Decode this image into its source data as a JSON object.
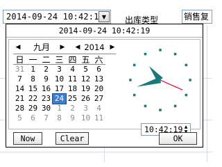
{
  "background": {
    "date_field_value": "2014-09-24 10:42:19",
    "outbound_type_label": "出库类型",
    "sales_box_text": "销售复"
  },
  "picker": {
    "title": "2014-09-24 10:42:19",
    "month": "九月",
    "year": "2014",
    "weekdays": [
      "日",
      "一",
      "二",
      "三",
      "四",
      "五",
      "六"
    ],
    "weeks": [
      [
        "31",
        "1",
        "2",
        "3",
        "4",
        "5",
        "6"
      ],
      [
        "7",
        "8",
        "9",
        "10",
        "11",
        "12",
        "13"
      ],
      [
        "14",
        "15",
        "16",
        "17",
        "18",
        "19",
        "20"
      ],
      [
        "21",
        "22",
        "23",
        "24",
        "25",
        "26",
        "27"
      ],
      [
        "28",
        "29",
        "30",
        "1",
        "2",
        "3",
        "4"
      ],
      [
        "5",
        "6",
        "7",
        "8",
        "9",
        "10",
        "11"
      ]
    ],
    "selected_day": "24",
    "time_value": "10:42:19",
    "buttons": {
      "now": "Now",
      "clear": "Clear",
      "ok": "OK"
    }
  },
  "colors": {
    "selection": "#3b7fd3",
    "clock_hour_minute": "#1a7a7a",
    "clock_second": "#e0001a"
  },
  "icons": {
    "nav_prev": "triangle-left-icon",
    "nav_next": "triangle-right-icon",
    "dropdown": "triangle-down-icon"
  }
}
